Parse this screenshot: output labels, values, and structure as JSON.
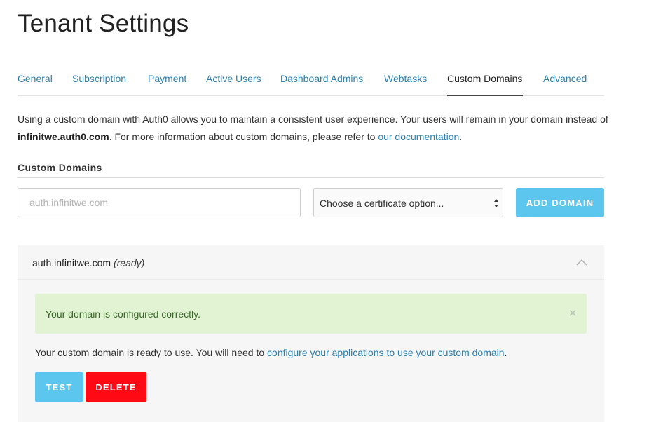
{
  "page": {
    "title": "Tenant Settings"
  },
  "tabs": [
    {
      "label": "General",
      "active": false
    },
    {
      "label": "Subscription",
      "active": false
    },
    {
      "label": "Payment",
      "active": false
    },
    {
      "label": "Active Users",
      "active": false
    },
    {
      "label": "Dashboard Admins",
      "active": false
    },
    {
      "label": "Webtasks",
      "active": false
    },
    {
      "label": "Custom Domains",
      "active": true
    },
    {
      "label": "Advanced",
      "active": false
    }
  ],
  "intro": {
    "text_1": "Using a custom domain with Auth0 allows you to maintain a consistent user experience. Your users will remain in your domain instead of",
    "default_domain": "infinitwe.auth0.com",
    "text_2": ". For more information about custom domains, please refer to ",
    "link_label": "our documentation",
    "text_3": "."
  },
  "custom_domains": {
    "section_label": "Custom Domains",
    "input_placeholder": "auth.infinitwe.com",
    "input_value": "",
    "certificate_select": {
      "selected": "Choose a certificate option..."
    },
    "add_button_label": "ADD DOMAIN"
  },
  "domain_panel": {
    "domain": "auth.infinitwe.com",
    "status": "(ready)",
    "expanded": true,
    "alert": {
      "message": "Your domain is configured correctly.",
      "close_glyph": "×"
    },
    "ready_text": "Your custom domain is ready to use. You will need to ",
    "ready_link": "configure your applications to use your custom domain",
    "ready_text_end": ".",
    "test_button_label": "TEST",
    "delete_button_label": "DELETE"
  },
  "colors": {
    "accent_blue": "#5cc6ef",
    "link_blue": "#2d7fb0",
    "danger_red": "#ff0a14",
    "success_bg": "#e1f3d3",
    "success_text": "#3c6a2b"
  },
  "icons": {
    "select_arrows": "up-down-caret-icon",
    "panel_toggle": "chevron-up-icon",
    "alert_close": "close-icon"
  }
}
